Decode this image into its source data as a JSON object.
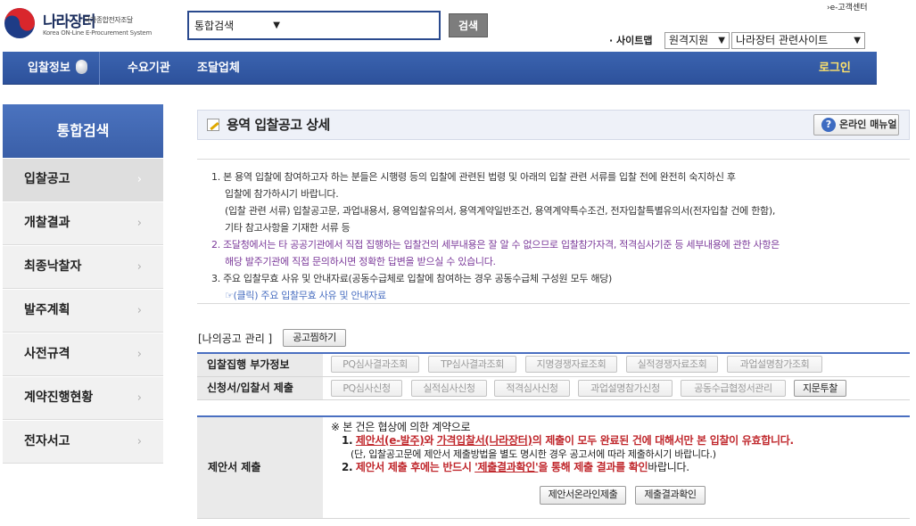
{
  "header": {
    "logo_kr": "나라장터",
    "logo_sub": "국가종합전자조달",
    "logo_en": "Korea ON-Line E-Procurement System",
    "search_scope": "통합검색",
    "search_button": "검색",
    "customer_center": "›e-고객센터",
    "sitemap": "· 사이트맵",
    "remote_support": "원격지원",
    "related_sites": "나라장터 관련사이트"
  },
  "nav": {
    "bid_info": "입찰정보",
    "demand_org": "수요기관",
    "vendor": "조달업체",
    "login": "로그인"
  },
  "sidebar": {
    "title": "통합검색",
    "items": [
      {
        "label": "입찰공고",
        "active": true
      },
      {
        "label": "개찰결과",
        "active": false
      },
      {
        "label": "최종낙찰자",
        "active": false
      },
      {
        "label": "발주계획",
        "active": false
      },
      {
        "label": "사전규격",
        "active": false
      },
      {
        "label": "계약진행현황",
        "active": false
      },
      {
        "label": "전자서고",
        "active": false
      }
    ]
  },
  "page": {
    "title": "용역 입찰공고 상세",
    "manual_button": "온라인 매뉴얼"
  },
  "notice": {
    "lines": [
      "1. 본 용역 입찰에 참여하고자 하는 분들은 시행령 등의 입찰에 관련된 법령 및 아래의 입찰 관련 서류를 입찰 전에 완전히 숙지하신 후",
      "입찰에 참가하시기 바랍니다.",
      "(입찰 관련 서류) 입찰공고문, 과업내용서, 용역입찰유의서, 용역계약일반조건, 용역계약특수조건, 전자입찰특별유의서(전자입찰 건에 한함),",
      "기타 참고사항을 기재한 서류 등",
      "2. 조달청에서는 타 공공기관에서 직접 집행하는 입찰건의 세부내용은 잘 알 수 없으므로 입찰참가자격, 적격심사기준 등 세부내용에 관한 사항은",
      "해당 발주기관에 직접 문의하시면 정확한 답변을 받으실 수 있습니다.",
      "3. 주요 입찰무효 사유 및 안내자료(공동수급체로 입찰에 참여하는 경우 공동수급체 구성원 모두 해당)",
      "☞(클릭) 주요 입찰무효 사유 및 안내자료"
    ]
  },
  "my_notice": {
    "label": "[나의공고 관리 ]",
    "bookmark_button": "공고찜하기"
  },
  "bid_extra": {
    "label": "입찰집행 부가정보",
    "buttons": [
      "PQ심사결과조회",
      "TP심사결과조회",
      "지명경쟁자료조회",
      "실적경쟁자료조회",
      "과업설명참가조회"
    ]
  },
  "application": {
    "label": "신청서/입찰서 제출",
    "buttons": [
      "PQ심사신청",
      "실적심사신청",
      "적격심사신청",
      "과업설명참가신청",
      "공동수급협정서관리",
      "지문투찰"
    ]
  },
  "proposal": {
    "label": "제안서 제출",
    "intro": "※ 본 건은 협상에 의한 계약으로",
    "item1_num": "1.",
    "item1_u1": "제안서(e-발주)",
    "item1_mid": "와",
    "item1_u2": "가격입찰서(나라장터)",
    "item1_rest": "의 제출이 모두 완료된 건에 대해서만 본 입찰이 유효합니다.",
    "item1_note": "(단, 입찰공고문에 제안서 제출방법을 별도 명시한 경우 공고서에 따라 제출하시기 바랍니다.)",
    "item2_num": "2.",
    "item2_red": "제안서 제출 후에는 반드시",
    "item2_link": "'제출결과확인'",
    "item2_mid": "을 통해 제출 결과를 확인",
    "item2_end": "바랍니다.",
    "online_submit_button": "제안서온라인제출",
    "result_check_button": "제출결과확인"
  }
}
